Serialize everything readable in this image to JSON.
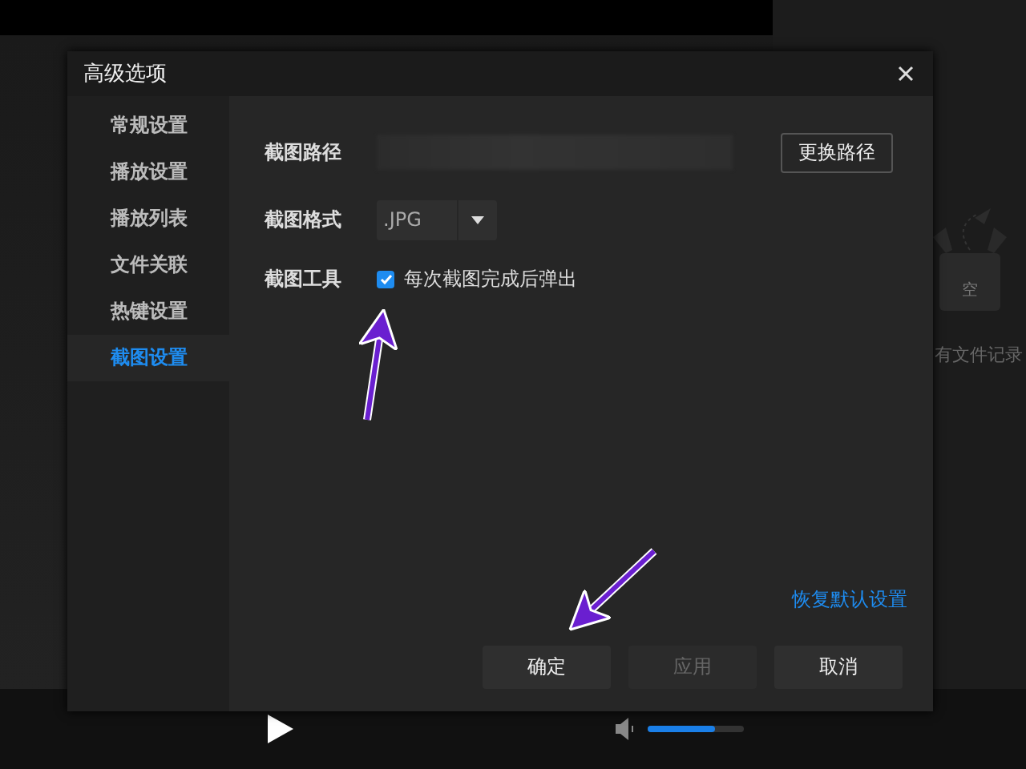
{
  "player": {
    "empty_text": "有文件记录",
    "box_label": "空",
    "volume": {
      "level": 0.7
    }
  },
  "dialog": {
    "title": "高级选项",
    "sidebar": {
      "items": [
        {
          "label": "常规设置",
          "selected": false
        },
        {
          "label": "播放设置",
          "selected": false
        },
        {
          "label": "播放列表",
          "selected": false
        },
        {
          "label": "文件关联",
          "selected": false
        },
        {
          "label": "热键设置",
          "selected": false
        },
        {
          "label": "截图设置",
          "selected": true
        }
      ]
    },
    "settings": [
      {
        "kind": "path",
        "label": "截图路径",
        "button": "更换路径"
      },
      {
        "kind": "select",
        "label": "截图格式",
        "value": ".JPG"
      },
      {
        "kind": "checkbox",
        "label": "截图工具",
        "option": "每次截图完成后弹出",
        "checked": true
      }
    ],
    "restore_link": "恢复默认设置",
    "buttons": [
      {
        "label": "确定",
        "disabled": false
      },
      {
        "label": "应用",
        "disabled": true
      },
      {
        "label": "取消",
        "disabled": false
      }
    ]
  }
}
